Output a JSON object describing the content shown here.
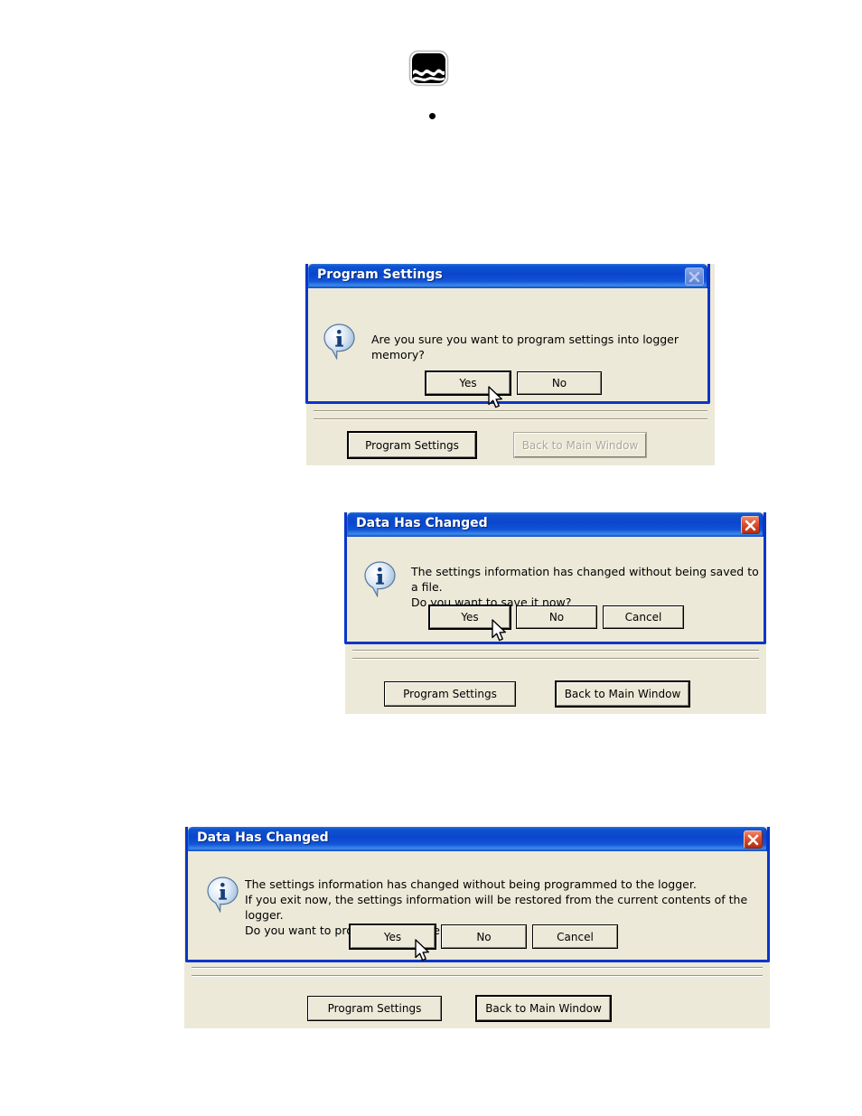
{
  "page": {
    "background_color": "#ffffff",
    "dialog_face_color": "#ece9d8",
    "title_bar_color": "#0a46cd",
    "close_button_color": "#c5381a"
  },
  "top_graphic": {
    "icon_name": "wave-logger-icon",
    "bullet_name": "bullet-point"
  },
  "sections": [
    {
      "id": "section-program-settings",
      "dialog": {
        "title": "Program Settings",
        "close_icon": "close-icon",
        "close_enabled": false,
        "info_icon": "info-balloon-icon",
        "message": "Are you sure you want to program settings into logger memory?",
        "buttons": [
          {
            "label": "Yes",
            "default": true,
            "disabled": false
          },
          {
            "label": "No",
            "default": false,
            "disabled": false
          }
        ],
        "cursor_icon": "mouse-pointer-icon"
      },
      "panel_buttons": [
        {
          "label": "Program Settings",
          "default": true,
          "disabled": false
        },
        {
          "label": "Back to Main Window",
          "default": false,
          "disabled": true
        }
      ]
    },
    {
      "id": "section-data-has-changed-save",
      "dialog": {
        "title": "Data Has Changed",
        "close_icon": "close-icon",
        "close_enabled": true,
        "info_icon": "info-balloon-icon",
        "message": "The settings information has changed without being saved to a file.\nDo you want to save it now?",
        "buttons": [
          {
            "label": "Yes",
            "default": true,
            "disabled": false
          },
          {
            "label": "No",
            "default": false,
            "disabled": false
          },
          {
            "label": "Cancel",
            "default": false,
            "disabled": false
          }
        ],
        "cursor_icon": "mouse-pointer-icon"
      },
      "panel_buttons": [
        {
          "label": "Program Settings",
          "default": false,
          "disabled": false
        },
        {
          "label": "Back to Main Window",
          "default": true,
          "disabled": false
        }
      ]
    },
    {
      "id": "section-data-has-changed-program",
      "dialog": {
        "title": "Data Has Changed",
        "close_icon": "close-icon",
        "close_enabled": true,
        "info_icon": "info-balloon-icon",
        "message": "The settings information has changed without being programmed to the logger.\nIf you exit now, the settings information will be restored from the current contents of the logger.\nDo you want to program the logger now?",
        "buttons": [
          {
            "label": "Yes",
            "default": true,
            "disabled": false
          },
          {
            "label": "No",
            "default": false,
            "disabled": false
          },
          {
            "label": "Cancel",
            "default": false,
            "disabled": false
          }
        ],
        "cursor_icon": "mouse-pointer-icon"
      },
      "panel_buttons": [
        {
          "label": "Program Settings",
          "default": false,
          "disabled": false
        },
        {
          "label": "Back to Main Window",
          "default": true,
          "disabled": false
        }
      ]
    }
  ]
}
